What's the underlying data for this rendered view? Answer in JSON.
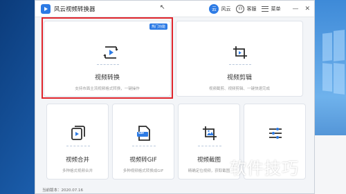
{
  "window": {
    "title": "风云视频转换器"
  },
  "titlebar": {
    "user_avatar": "云",
    "user_label": "风云",
    "service_label": "客服",
    "menu_label": "菜单",
    "minimize": "—",
    "close": "✕"
  },
  "cards": {
    "convert": {
      "title": "视频转换",
      "desc": "支持市面主流视频格式转换，一键操作",
      "badge": "热门功能",
      "icon": "video-play-icon"
    },
    "edit": {
      "title": "视频剪辑",
      "desc": "视频截剪、视频剪辑、一键快速完成",
      "icon": "crop-icon"
    },
    "merge": {
      "title": "视频合并",
      "desc": "多种格式视频合并",
      "icon": "video-stack-icon"
    },
    "gif": {
      "title": "视频转GIF",
      "desc": "多种视频格式转换成GIF",
      "icon": "gif-file-icon",
      "icon_text": "GIF"
    },
    "snapshot": {
      "title": "视频截图",
      "desc": "精确定位视频，获取截图",
      "icon": "image-crop-icon"
    },
    "more": {
      "icon": "sliders-icon"
    }
  },
  "footer": {
    "version": "当前版本：2020.07.16"
  },
  "watermark": "软件技巧",
  "colors": {
    "accent": "#2d7be5",
    "selection": "#e0242b",
    "card_bg": "#ffffff",
    "window_bg": "#f3f5f8"
  }
}
